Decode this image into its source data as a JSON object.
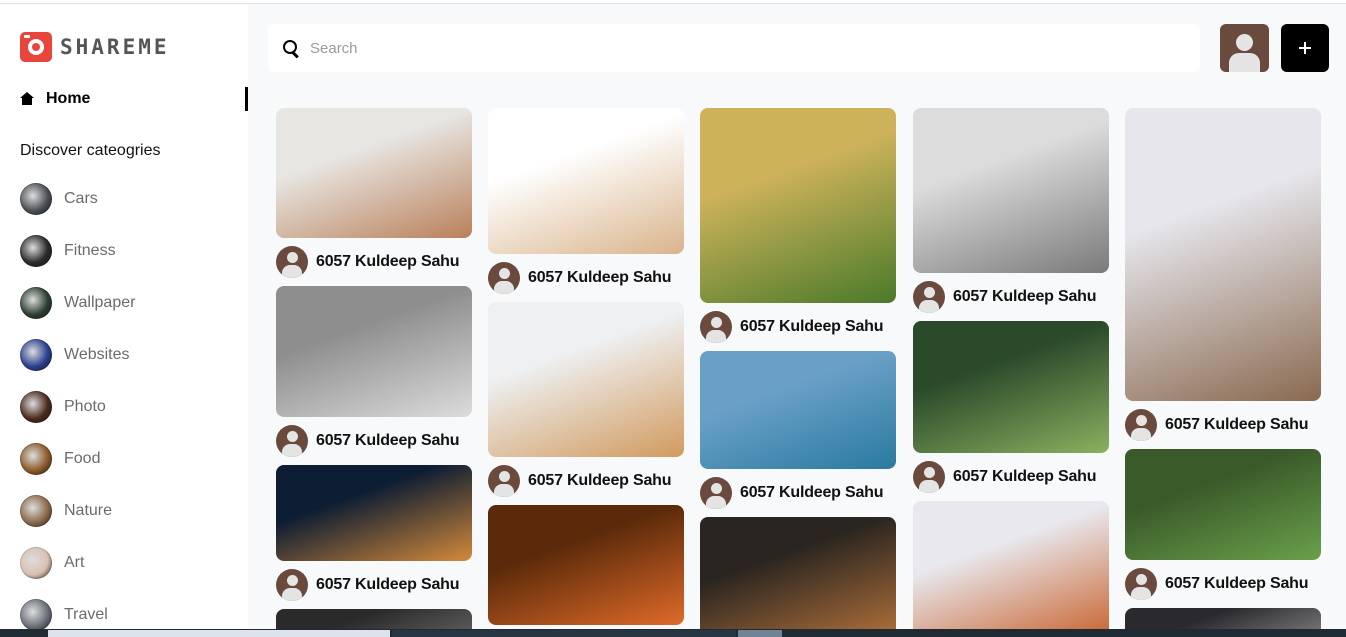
{
  "app": {
    "logo_text": "SHAREME"
  },
  "sidebar": {
    "home_label": "Home",
    "discover_heading": "Discover cateogries",
    "categories": [
      {
        "label": "Cars",
        "color": "#4b4f55"
      },
      {
        "label": "Fitness",
        "color": "#2a2a2a"
      },
      {
        "label": "Wallpaper",
        "color": "#2d4030"
      },
      {
        "label": "Websites",
        "color": "#2b3f8e"
      },
      {
        "label": "Photo",
        "color": "#4a2a1e"
      },
      {
        "label": "Food",
        "color": "#8a5a2a"
      },
      {
        "label": "Nature",
        "color": "#8a6a4a"
      },
      {
        "label": "Art",
        "color": "#d9c0b0"
      },
      {
        "label": "Travel",
        "color": "#6a6f78"
      }
    ]
  },
  "header": {
    "search_placeholder": "Search"
  },
  "feed": {
    "columns": [
      [
        {
          "image": "poodle-dog",
          "colors": [
            "#e8e6e3",
            "#b9805a"
          ],
          "author": "6057 Kuldeep Sahu"
        },
        {
          "image": "grey-persian-cat",
          "colors": [
            "#8e8e8e",
            "#dcdcdc"
          ],
          "author": "6057 Kuldeep Sahu"
        },
        {
          "image": "fast-food",
          "colors": [
            "#0d1d33",
            "#d48a3a"
          ],
          "author": "6057 Kuldeep Sahu"
        },
        {
          "image": "partial-image",
          "colors": [
            "#2a2a2a",
            "#6a6a6a"
          ],
          "author": ""
        }
      ],
      [
        {
          "image": "pug-dog",
          "colors": [
            "#ffffff",
            "#d9b48c"
          ],
          "author": "6057 Kuldeep Sahu"
        },
        {
          "image": "orange-cat",
          "colors": [
            "#eef0f2",
            "#d19a5e"
          ],
          "author": "6057 Kuldeep Sahu"
        },
        {
          "image": "pasta-dish",
          "colors": [
            "#5a2a0a",
            "#e06a2a"
          ],
          "author": ""
        }
      ],
      [
        {
          "image": "golden-retriever",
          "colors": [
            "#cdb25a",
            "#4a7a2a"
          ],
          "author": "6057 Kuldeep Sahu"
        },
        {
          "image": "mountain-lake",
          "colors": [
            "#6aa0c8",
            "#2a7aa0"
          ],
          "author": "6057 Kuldeep Sahu"
        },
        {
          "image": "food-bowls",
          "colors": [
            "#2a2520",
            "#b0703a"
          ],
          "author": ""
        }
      ],
      [
        {
          "image": "white-grey-cat",
          "colors": [
            "#dcdcdc",
            "#7a7a7a"
          ],
          "author": "6057 Kuldeep Sahu"
        },
        {
          "image": "forest-stream",
          "colors": [
            "#2a4a2a",
            "#8ab060"
          ],
          "author": "6057 Kuldeep Sahu"
        },
        {
          "image": "roasted-salmon",
          "colors": [
            "#e8e8ee",
            "#c8602a"
          ],
          "author": ""
        }
      ],
      [
        {
          "image": "tabby-cat",
          "colors": [
            "#e6e6ec",
            "#8a6a50"
          ],
          "author": "6057 Kuldeep Sahu"
        },
        {
          "image": "tree-in-globe",
          "colors": [
            "#3a5a2a",
            "#6aa04a"
          ],
          "author": "6057 Kuldeep Sahu"
        },
        {
          "image": "partial-image",
          "colors": [
            "#2a2a2e",
            "#8a8a8a"
          ],
          "author": ""
        }
      ]
    ]
  }
}
